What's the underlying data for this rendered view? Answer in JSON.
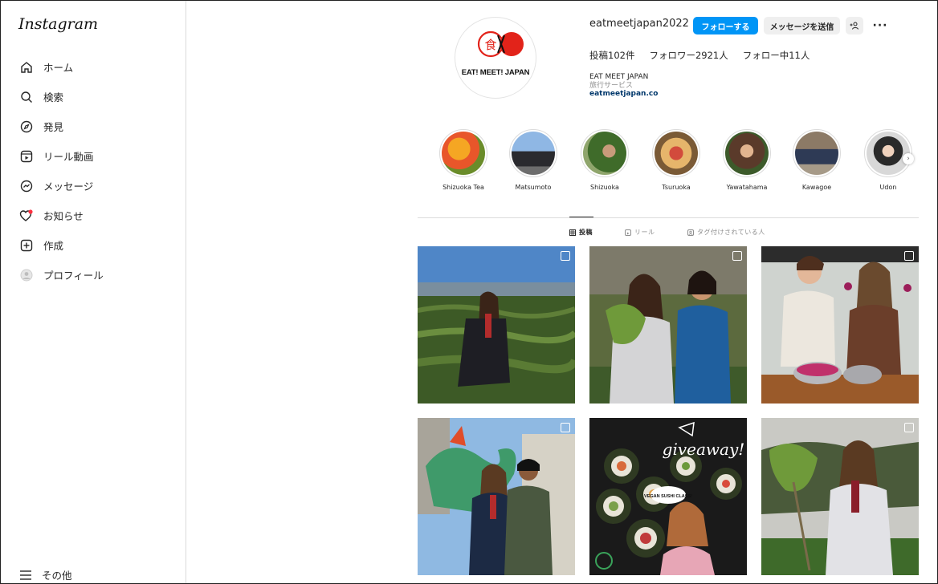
{
  "sidebar": {
    "logo": "Instagram",
    "items": [
      {
        "label": "ホーム",
        "icon": "home-icon"
      },
      {
        "label": "検索",
        "icon": "search-icon"
      },
      {
        "label": "発見",
        "icon": "compass-icon"
      },
      {
        "label": "リール動画",
        "icon": "reels-icon"
      },
      {
        "label": "メッセージ",
        "icon": "messenger-icon"
      },
      {
        "label": "お知らせ",
        "icon": "heart-icon"
      },
      {
        "label": "作成",
        "icon": "plus-square-icon"
      },
      {
        "label": "プロフィール",
        "icon": "avatar-icon"
      }
    ],
    "more_label": "その他"
  },
  "profile": {
    "avatar_text": "EAT! MEET! JAPAN",
    "avatar_kanji": "食",
    "username": "eatmeetjapan2022",
    "follow_label": "フォローする",
    "message_label": "メッセージを送信",
    "stats": {
      "posts": "投稿102件",
      "followers": "フォロワー2921人",
      "following": "フォロー中11人"
    },
    "bio": {
      "name": "EAT MEET JAPAN",
      "category": "旅行サービス",
      "link": "eatmeetjapan.co"
    }
  },
  "highlights": [
    {
      "label": "Shizuoka Tea"
    },
    {
      "label": "Matsumoto"
    },
    {
      "label": "Shizuoka"
    },
    {
      "label": "Tsuruoka"
    },
    {
      "label": "Yawatahama"
    },
    {
      "label": "Kawagoe"
    },
    {
      "label": "Udon"
    }
  ],
  "tabs": [
    {
      "label": "投稿",
      "active": true
    },
    {
      "label": "リール",
      "active": false
    },
    {
      "label": "タグ付けされている人",
      "active": false
    }
  ],
  "posts": [
    {
      "scene": "woman-in-tea-field"
    },
    {
      "scene": "two-women-with-wasabi-greens"
    },
    {
      "scene": "two-people-with-bowls-of-flowers"
    },
    {
      "scene": "two-people-with-dragon-statue"
    },
    {
      "scene": "vegan-sushi-giveaway",
      "text1": "giveaway!",
      "text2": "VEGAN SUSHI CLASS!"
    },
    {
      "scene": "woman-holding-wasabi-plant"
    }
  ],
  "colors": {
    "accent": "#0095f6",
    "link": "#00376b",
    "border": "#dbdbdb"
  }
}
